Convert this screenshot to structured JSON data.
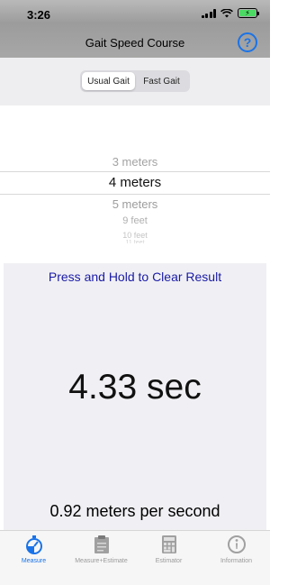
{
  "status": {
    "time": "3:26",
    "battery_symbol": "⚡"
  },
  "nav": {
    "title": "Gait Speed Course",
    "help_label": "?"
  },
  "segment": {
    "options": [
      "Usual Gait",
      "Fast Gait"
    ],
    "selected_index": 0
  },
  "picker": {
    "items": [
      "3 meters",
      "4 meters",
      "5 meters",
      "9 feet",
      "10 feet",
      "11 feet"
    ],
    "selected": "4 meters"
  },
  "result": {
    "hint": "Press and Hold to Clear Result",
    "time": "4.33 sec",
    "speed": "0.92 meters per second"
  },
  "tabs": [
    {
      "label": "Measure",
      "icon": "stopwatch-icon",
      "active": true
    },
    {
      "label": "Measure+Estimate",
      "icon": "clipboard-icon",
      "active": false
    },
    {
      "label": "Estimator",
      "icon": "calculator-icon",
      "active": false
    },
    {
      "label": "Information",
      "icon": "info-icon",
      "active": false
    }
  ],
  "colors": {
    "accent": "#1a73e8",
    "hint": "#1a1aa6",
    "battery": "#4cd964"
  }
}
